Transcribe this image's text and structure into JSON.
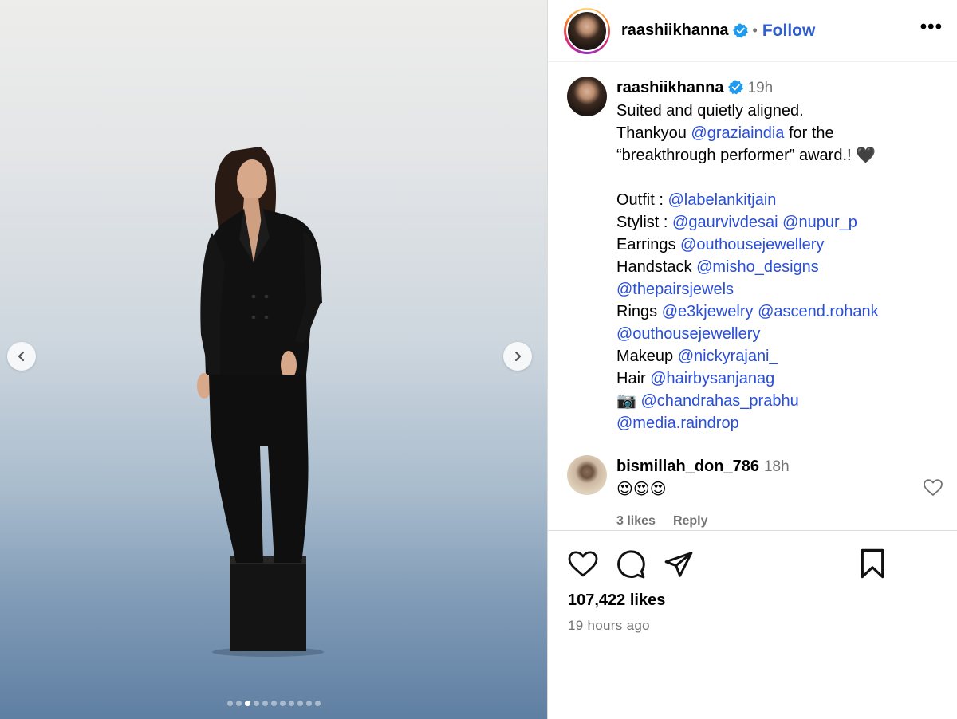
{
  "media": {
    "slide_count": 11,
    "active_slide_index": 2
  },
  "header": {
    "username": "raashiikhanna",
    "separator": "•",
    "follow_label": "Follow",
    "more_label": "•••"
  },
  "caption": {
    "username": "raashiikhanna",
    "time": "19h",
    "lines": [
      [
        {
          "t": "Suited and quietly aligned."
        }
      ],
      [
        {
          "t": "Thankyou "
        },
        {
          "t": "@graziaindia",
          "m": true
        },
        {
          "t": " for the"
        }
      ],
      [
        {
          "t": "“breakthrough performer” award.! 🖤"
        }
      ],
      [],
      [
        {
          "t": "Outfit : "
        },
        {
          "t": "@labelankitjain",
          "m": true
        }
      ],
      [
        {
          "t": "Stylist : "
        },
        {
          "t": "@gaurvivdesai",
          "m": true
        },
        {
          "t": " "
        },
        {
          "t": "@nupur_p",
          "m": true
        }
      ],
      [
        {
          "t": "Earrings "
        },
        {
          "t": "@outhousejewellery",
          "m": true
        }
      ],
      [
        {
          "t": "Handstack "
        },
        {
          "t": "@misho_designs",
          "m": true
        }
      ],
      [
        {
          "t": "@thepairsjewels",
          "m": true
        }
      ],
      [
        {
          "t": "Rings "
        },
        {
          "t": "@e3kjewelry",
          "m": true
        },
        {
          "t": " "
        },
        {
          "t": "@ascend.rohank",
          "m": true
        }
      ],
      [
        {
          "t": "@outhousejewellery",
          "m": true
        }
      ],
      [
        {
          "t": "Makeup "
        },
        {
          "t": "@nickyrajani_",
          "m": true
        }
      ],
      [
        {
          "t": "Hair "
        },
        {
          "t": "@hairbysanjanag",
          "m": true
        }
      ],
      [
        {
          "t": "📷  "
        },
        {
          "t": "@chandrahas_prabhu",
          "m": true
        }
      ],
      [
        {
          "t": "@media.raindrop",
          "m": true
        }
      ]
    ]
  },
  "comment": {
    "username": "bismillah_don_786",
    "time": "18h",
    "text": "😍😍😍",
    "likes_label": "3 likes",
    "reply_label": "Reply"
  },
  "footer": {
    "likes": "107,422 likes",
    "time_ago": "19 hours ago"
  },
  "colors": {
    "mention": "#2a4fd6",
    "verified": "#1d9bf0",
    "secondary_text": "#737373"
  },
  "icons": [
    "chevron-left-icon",
    "chevron-right-icon",
    "verified-badge-icon",
    "heart-icon",
    "comment-icon",
    "share-icon",
    "bookmark-icon"
  ]
}
